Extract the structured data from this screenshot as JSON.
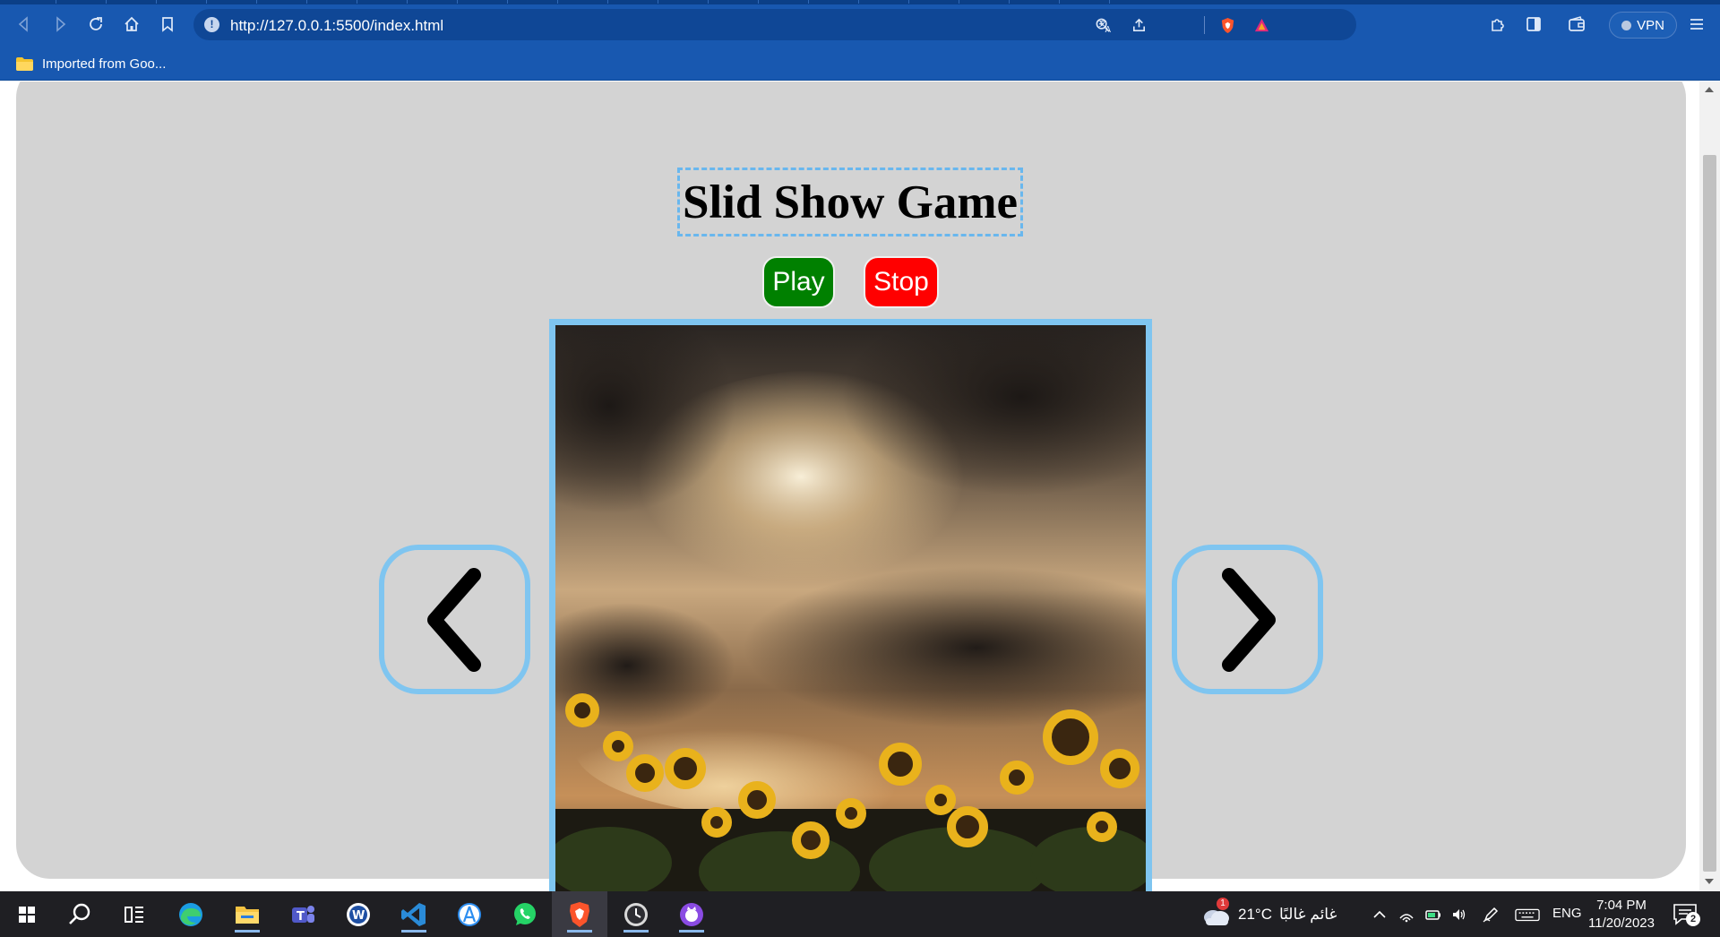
{
  "browser": {
    "url": "http://127.0.0.1:5500/index.html",
    "bookmark_folder": "Imported from Goo...",
    "vpn_label": "VPN"
  },
  "page": {
    "title": "Slid Show Game",
    "play_label": "Play",
    "stop_label": "Stop",
    "slide_image_description": "sunflowers under a dramatic cloudy sunset sky",
    "colors": {
      "page_background": "#d3d3d3",
      "play": "#008000",
      "stop": "#ff0000",
      "frame_border": "#7fc5f0"
    }
  },
  "taskbar": {
    "pinned_apps": [
      "start",
      "search",
      "task-view",
      "edge",
      "file-explorer",
      "teams",
      "word",
      "vscode",
      "app-store",
      "whatsapp",
      "brave",
      "clock-app",
      "github-desktop"
    ],
    "weather_temp": "21°C",
    "weather_text": "غائم غالبًا",
    "weather_badge": "1",
    "language": "ENG",
    "time": "7:04 PM",
    "date": "11/20/2023",
    "notification_count": "2"
  }
}
